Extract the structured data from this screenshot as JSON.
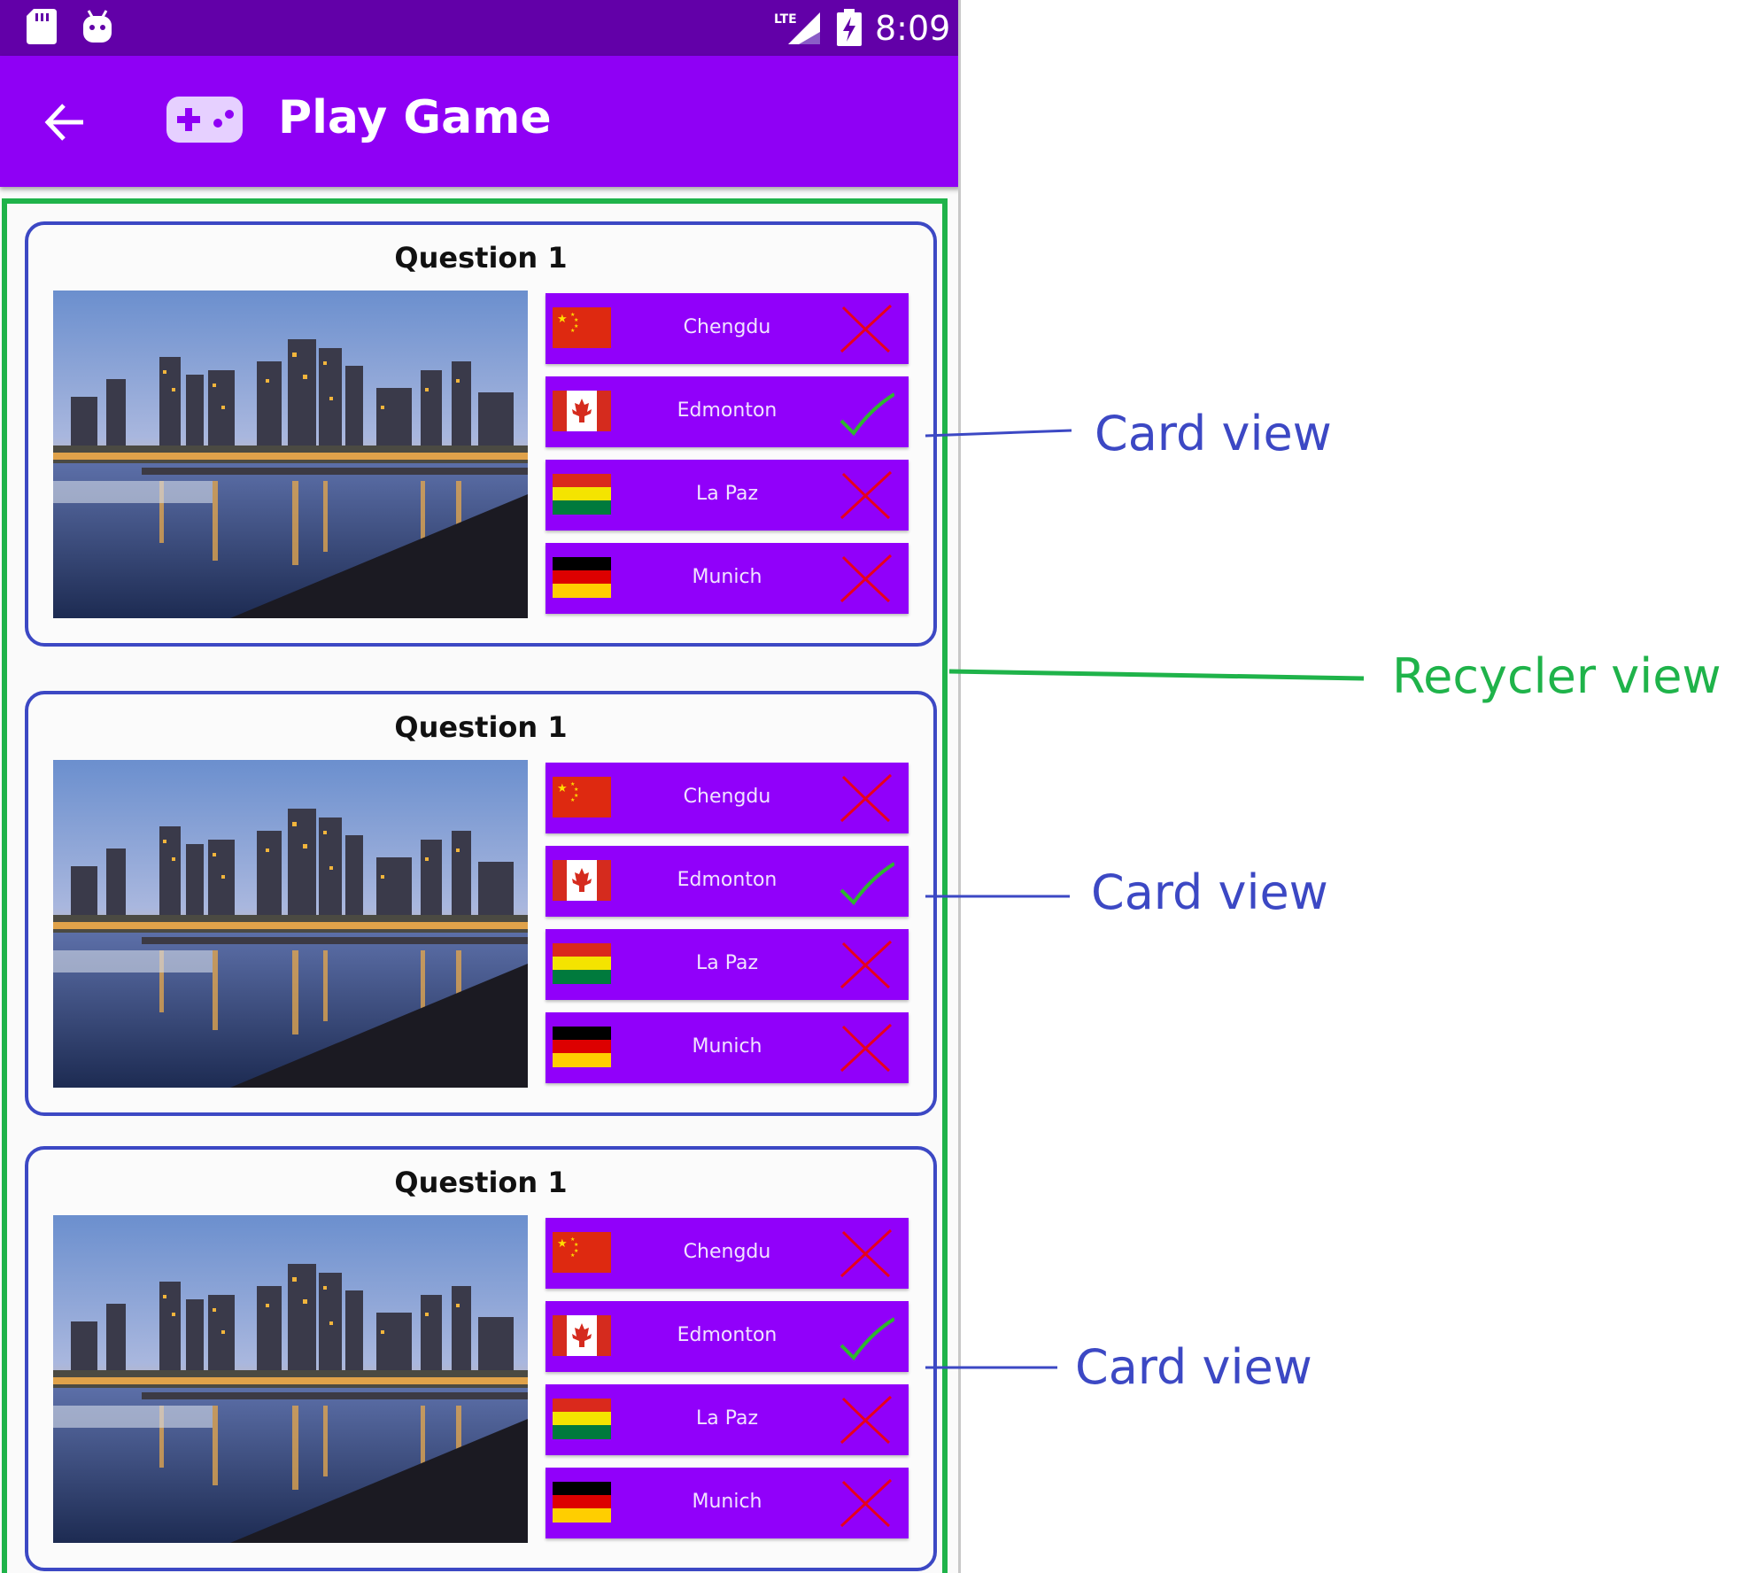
{
  "status_bar": {
    "time": "8:09",
    "network_label": "LTE",
    "icons": [
      "sd-card-icon",
      "android-icon",
      "lte-signal-icon",
      "battery-charging-icon"
    ]
  },
  "app_bar": {
    "title": "Play Game",
    "icons": [
      "back-arrow-icon",
      "gamepad-icon"
    ]
  },
  "cards": [
    {
      "title": "Question 1",
      "options": [
        {
          "label": "Chengdu",
          "flag": "china",
          "result": "wrong"
        },
        {
          "label": "Edmonton",
          "flag": "canada",
          "result": "correct"
        },
        {
          "label": "La Paz",
          "flag": "bolivia",
          "result": "wrong"
        },
        {
          "label": "Munich",
          "flag": "germany",
          "result": "wrong"
        }
      ]
    },
    {
      "title": "Question 1",
      "options": [
        {
          "label": "Chengdu",
          "flag": "china",
          "result": "wrong"
        },
        {
          "label": "Edmonton",
          "flag": "canada",
          "result": "correct"
        },
        {
          "label": "La Paz",
          "flag": "bolivia",
          "result": "wrong"
        },
        {
          "label": "Munich",
          "flag": "germany",
          "result": "wrong"
        }
      ]
    },
    {
      "title": "Question 1",
      "options": [
        {
          "label": "Chengdu",
          "flag": "china",
          "result": "wrong"
        },
        {
          "label": "Edmonton",
          "flag": "canada",
          "result": "correct"
        },
        {
          "label": "La Paz",
          "flag": "bolivia",
          "result": "wrong"
        },
        {
          "label": "Munich",
          "flag": "germany",
          "result": "wrong"
        }
      ]
    }
  ],
  "annotations": {
    "card_view": [
      "Card view",
      "Card view",
      "Card view"
    ],
    "recycler_view": "Recycler view"
  },
  "colors": {
    "status_bar": "#6200a8",
    "app_bar": "#8f00f5",
    "option_button": "#9100fa",
    "card_outline": "#3c48c4",
    "recycler_outline": "#1fb34a",
    "correct_mark": "#2fb52f",
    "wrong_mark": "#e8001c"
  }
}
